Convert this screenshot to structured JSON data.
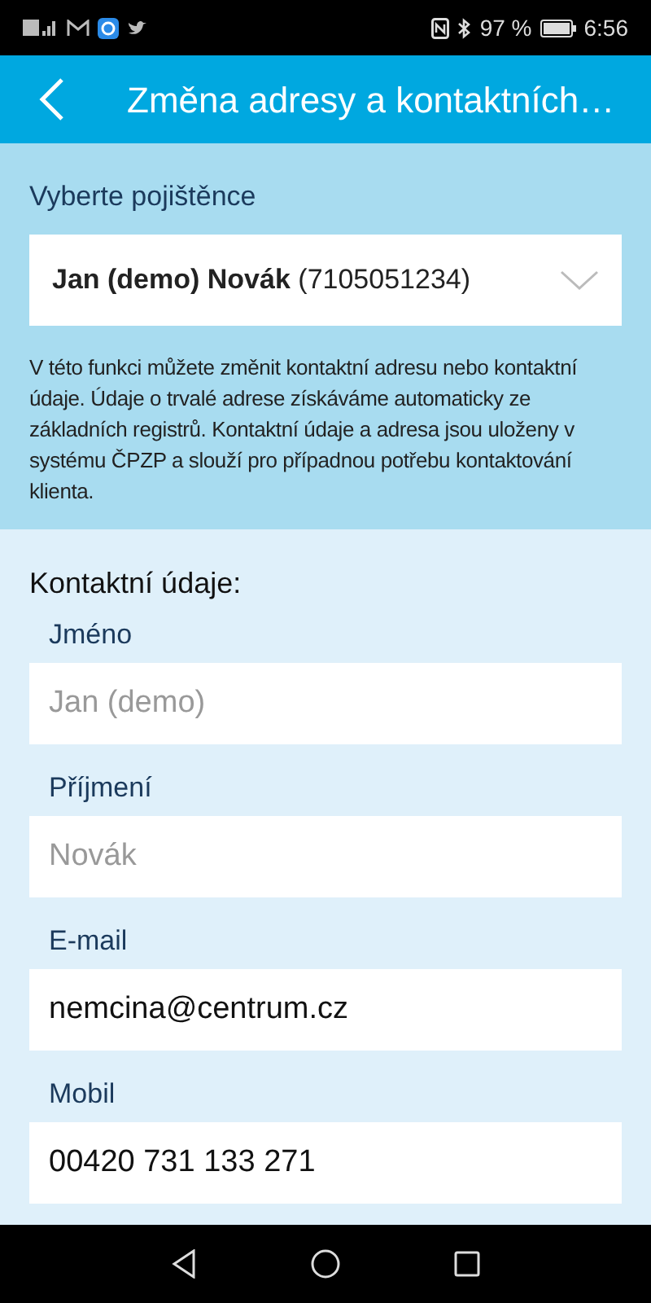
{
  "status_bar": {
    "battery_text": "97 %",
    "time": "6:56"
  },
  "header": {
    "title": "Změna adresy a kontaktních…"
  },
  "insured": {
    "label": "Vyberte pojištěnce",
    "value": "**Jan (demo) Novák** (7105051234)"
  },
  "info": "V této funkci můžete změnit kontaktní adresu nebo kontaktní údaje. Údaje o trvalé adrese získáváme automaticky ze základních registrů. Kontaktní údaje a adresa jsou uloženy v systému ČPZP a slouží pro případnou potřebu kontaktování klienta.",
  "contact": {
    "heading": "Kontaktní údaje:",
    "fields": [
      {
        "label": "Jméno",
        "placeholder": "Jan (demo)"
      },
      {
        "label": "Příjmení",
        "placeholder": "Novák"
      },
      {
        "label": "E-mail",
        "value": "nemcina@centrum.cz"
      },
      {
        "label": "Mobil",
        "value": "00420 731 133 271"
      }
    ]
  }
}
